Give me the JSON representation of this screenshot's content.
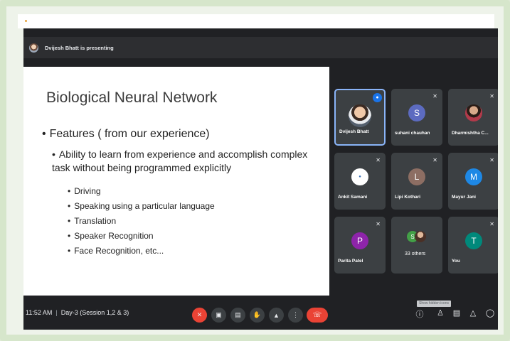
{
  "header": {
    "presenting_text": "Dvijesh Bhatt is presenting"
  },
  "slide": {
    "title": "Biological Neural Network",
    "bullet1": "Features ( from our experience)",
    "bullet2": "Ability to learn from experience and accomplish complex task without being programmed explicitly",
    "items": [
      "Driving",
      "Speaking using a particular language",
      "Translation",
      "Speaker Recognition",
      "Face Recognition, etc..."
    ]
  },
  "participants": [
    {
      "name": "Dvijesh Bhatt",
      "initial": "",
      "color": "#5f6368",
      "speaking": true
    },
    {
      "name": "suhani chauhan",
      "initial": "S",
      "color": "#5c6bc0"
    },
    {
      "name": "Dharmishtha C...",
      "initial": "",
      "color": "#795548"
    },
    {
      "name": "Ankit Samani",
      "initial": "",
      "color": "#ffffff"
    },
    {
      "name": "Lipi Kothari",
      "initial": "L",
      "color": "#8d6e63"
    },
    {
      "name": "Mayur Jani",
      "initial": "M",
      "color": "#1e88e5"
    },
    {
      "name": "Parita Patel",
      "initial": "P",
      "color": "#8e24aa"
    },
    {
      "name": "33 others",
      "initial": "S",
      "color": "#43a047"
    },
    {
      "name": "You",
      "initial": "T",
      "color": "#00897b"
    }
  ],
  "bottom": {
    "time": "11:52 AM",
    "meeting_name": "Day-3 (Session 1,2 & 3)",
    "participant_count": "42",
    "tooltip": "Show hidden icons"
  },
  "icons": {
    "mic": "mic-off-icon",
    "camera": "camera-icon",
    "captions": "captions-icon",
    "hand": "raise-hand-icon",
    "present": "present-icon",
    "more": "more-options-icon",
    "hangup": "hang-up-icon",
    "info": "info-icon",
    "people": "people-icon",
    "chat": "chat-icon",
    "activities": "activities-icon",
    "security": "host-controls-icon"
  }
}
